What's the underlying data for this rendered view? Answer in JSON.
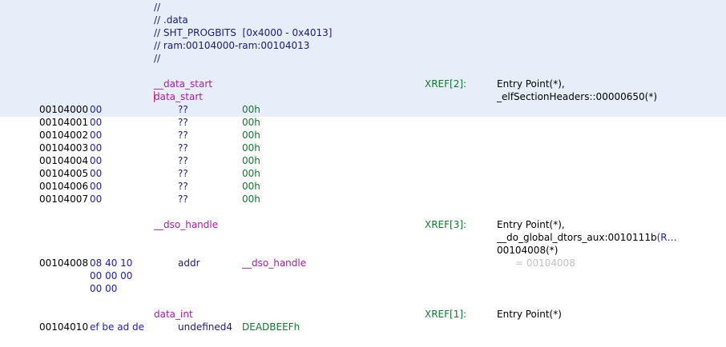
{
  "comments": [
    "//",
    "// .data",
    "// SHT_PROGBITS  [0x4000 - 0x4013]",
    "// ram:00104000-ram:00104013",
    "//"
  ],
  "data_start": {
    "label1": "__data_start",
    "label2": "data_start",
    "xref": "XREF[2]:",
    "refs": [
      "Entry Point(*),",
      "_elfSectionHeaders::00000650(*)"
    ]
  },
  "byte_rows": [
    {
      "addr": "00104000",
      "bytes": "00",
      "mnemonic": "??",
      "operand": "00h"
    },
    {
      "addr": "00104001",
      "bytes": "00",
      "mnemonic": "??",
      "operand": "00h"
    },
    {
      "addr": "00104002",
      "bytes": "00",
      "mnemonic": "??",
      "operand": "00h"
    },
    {
      "addr": "00104003",
      "bytes": "00",
      "mnemonic": "??",
      "operand": "00h"
    },
    {
      "addr": "00104004",
      "bytes": "00",
      "mnemonic": "??",
      "operand": "00h"
    },
    {
      "addr": "00104005",
      "bytes": "00",
      "mnemonic": "??",
      "operand": "00h"
    },
    {
      "addr": "00104006",
      "bytes": "00",
      "mnemonic": "??",
      "operand": "00h"
    },
    {
      "addr": "00104007",
      "bytes": "00",
      "mnemonic": "??",
      "operand": "00h"
    }
  ],
  "dso_handle": {
    "label": "__dso_handle",
    "xref": "XREF[3]:",
    "refs": [
      "Entry Point(*),",
      "__do_global_dtors_aux:0010111b",
      "(R…",
      "00104008(*)"
    ],
    "addr": "00104008",
    "bytes": [
      "08 40 10",
      "00 00 00",
      "00 00"
    ],
    "mnemonic": "addr",
    "operand": "__dso_handle",
    "value_comment": "= 00104008"
  },
  "data_int": {
    "label": "data_int",
    "xref": "XREF[1]:",
    "refs": [
      "Entry Point(*)"
    ],
    "addr": "00104010",
    "bytes": "ef be ad de",
    "mnemonic": "undefined4",
    "operand": "DEADBEEFh"
  }
}
